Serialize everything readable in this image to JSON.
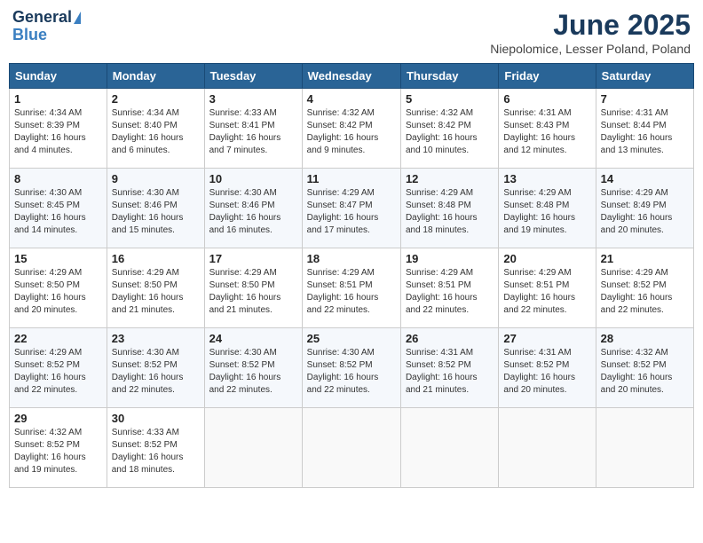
{
  "logo": {
    "general": "General",
    "blue": "Blue"
  },
  "title": "June 2025",
  "location": "Niepolomice, Lesser Poland, Poland",
  "days_header": [
    "Sunday",
    "Monday",
    "Tuesday",
    "Wednesday",
    "Thursday",
    "Friday",
    "Saturday"
  ],
  "weeks": [
    [
      {
        "day": "1",
        "info": "Sunrise: 4:34 AM\nSunset: 8:39 PM\nDaylight: 16 hours\nand 4 minutes."
      },
      {
        "day": "2",
        "info": "Sunrise: 4:34 AM\nSunset: 8:40 PM\nDaylight: 16 hours\nand 6 minutes."
      },
      {
        "day": "3",
        "info": "Sunrise: 4:33 AM\nSunset: 8:41 PM\nDaylight: 16 hours\nand 7 minutes."
      },
      {
        "day": "4",
        "info": "Sunrise: 4:32 AM\nSunset: 8:42 PM\nDaylight: 16 hours\nand 9 minutes."
      },
      {
        "day": "5",
        "info": "Sunrise: 4:32 AM\nSunset: 8:42 PM\nDaylight: 16 hours\nand 10 minutes."
      },
      {
        "day": "6",
        "info": "Sunrise: 4:31 AM\nSunset: 8:43 PM\nDaylight: 16 hours\nand 12 minutes."
      },
      {
        "day": "7",
        "info": "Sunrise: 4:31 AM\nSunset: 8:44 PM\nDaylight: 16 hours\nand 13 minutes."
      }
    ],
    [
      {
        "day": "8",
        "info": "Sunrise: 4:30 AM\nSunset: 8:45 PM\nDaylight: 16 hours\nand 14 minutes."
      },
      {
        "day": "9",
        "info": "Sunrise: 4:30 AM\nSunset: 8:46 PM\nDaylight: 16 hours\nand 15 minutes."
      },
      {
        "day": "10",
        "info": "Sunrise: 4:30 AM\nSunset: 8:46 PM\nDaylight: 16 hours\nand 16 minutes."
      },
      {
        "day": "11",
        "info": "Sunrise: 4:29 AM\nSunset: 8:47 PM\nDaylight: 16 hours\nand 17 minutes."
      },
      {
        "day": "12",
        "info": "Sunrise: 4:29 AM\nSunset: 8:48 PM\nDaylight: 16 hours\nand 18 minutes."
      },
      {
        "day": "13",
        "info": "Sunrise: 4:29 AM\nSunset: 8:48 PM\nDaylight: 16 hours\nand 19 minutes."
      },
      {
        "day": "14",
        "info": "Sunrise: 4:29 AM\nSunset: 8:49 PM\nDaylight: 16 hours\nand 20 minutes."
      }
    ],
    [
      {
        "day": "15",
        "info": "Sunrise: 4:29 AM\nSunset: 8:50 PM\nDaylight: 16 hours\nand 20 minutes."
      },
      {
        "day": "16",
        "info": "Sunrise: 4:29 AM\nSunset: 8:50 PM\nDaylight: 16 hours\nand 21 minutes."
      },
      {
        "day": "17",
        "info": "Sunrise: 4:29 AM\nSunset: 8:50 PM\nDaylight: 16 hours\nand 21 minutes."
      },
      {
        "day": "18",
        "info": "Sunrise: 4:29 AM\nSunset: 8:51 PM\nDaylight: 16 hours\nand 22 minutes."
      },
      {
        "day": "19",
        "info": "Sunrise: 4:29 AM\nSunset: 8:51 PM\nDaylight: 16 hours\nand 22 minutes."
      },
      {
        "day": "20",
        "info": "Sunrise: 4:29 AM\nSunset: 8:51 PM\nDaylight: 16 hours\nand 22 minutes."
      },
      {
        "day": "21",
        "info": "Sunrise: 4:29 AM\nSunset: 8:52 PM\nDaylight: 16 hours\nand 22 minutes."
      }
    ],
    [
      {
        "day": "22",
        "info": "Sunrise: 4:29 AM\nSunset: 8:52 PM\nDaylight: 16 hours\nand 22 minutes."
      },
      {
        "day": "23",
        "info": "Sunrise: 4:30 AM\nSunset: 8:52 PM\nDaylight: 16 hours\nand 22 minutes."
      },
      {
        "day": "24",
        "info": "Sunrise: 4:30 AM\nSunset: 8:52 PM\nDaylight: 16 hours\nand 22 minutes."
      },
      {
        "day": "25",
        "info": "Sunrise: 4:30 AM\nSunset: 8:52 PM\nDaylight: 16 hours\nand 22 minutes."
      },
      {
        "day": "26",
        "info": "Sunrise: 4:31 AM\nSunset: 8:52 PM\nDaylight: 16 hours\nand 21 minutes."
      },
      {
        "day": "27",
        "info": "Sunrise: 4:31 AM\nSunset: 8:52 PM\nDaylight: 16 hours\nand 20 minutes."
      },
      {
        "day": "28",
        "info": "Sunrise: 4:32 AM\nSunset: 8:52 PM\nDaylight: 16 hours\nand 20 minutes."
      }
    ],
    [
      {
        "day": "29",
        "info": "Sunrise: 4:32 AM\nSunset: 8:52 PM\nDaylight: 16 hours\nand 19 minutes."
      },
      {
        "day": "30",
        "info": "Sunrise: 4:33 AM\nSunset: 8:52 PM\nDaylight: 16 hours\nand 18 minutes."
      },
      {
        "day": "",
        "info": ""
      },
      {
        "day": "",
        "info": ""
      },
      {
        "day": "",
        "info": ""
      },
      {
        "day": "",
        "info": ""
      },
      {
        "day": "",
        "info": ""
      }
    ]
  ]
}
